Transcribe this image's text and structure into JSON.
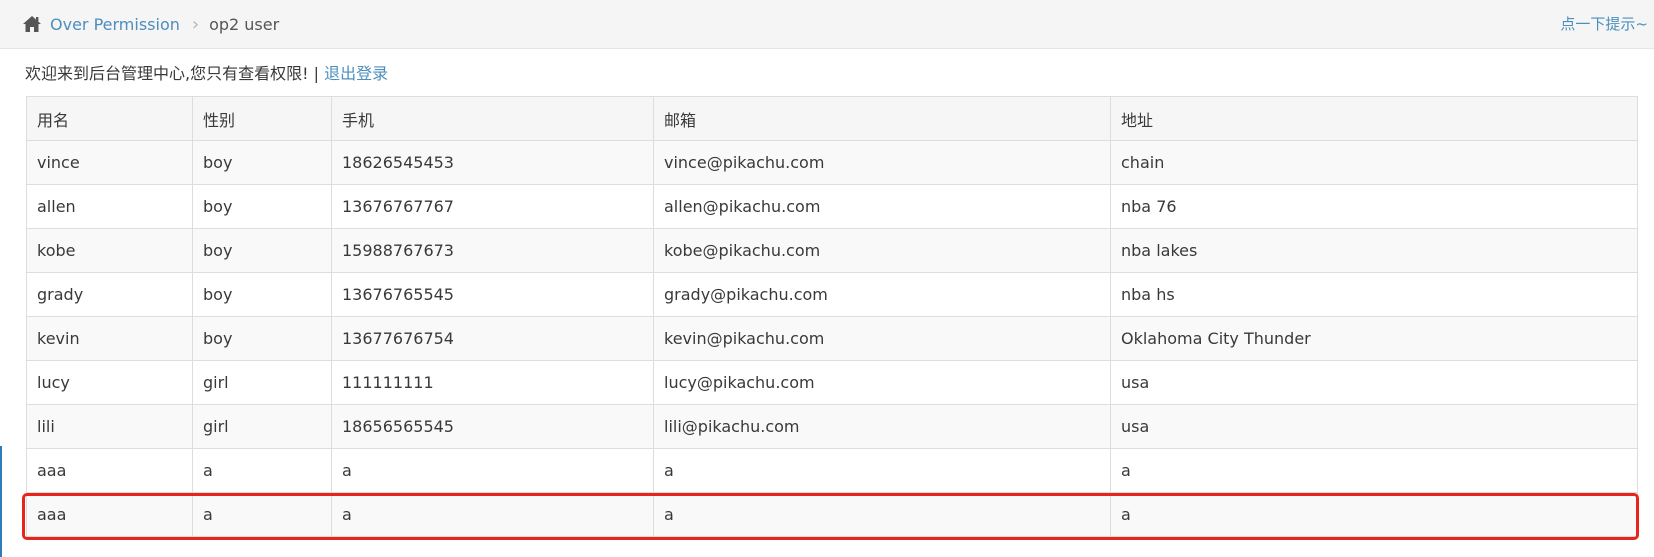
{
  "breadcrumb": {
    "home_icon": "home-icon",
    "link_label": "Over Permission",
    "separator": "›",
    "current": "op2 user"
  },
  "hint_link": "点一下提示~",
  "welcome": {
    "text": "欢迎来到后台管理中心,您只有查看权限! | ",
    "logout_label": "退出登录"
  },
  "table": {
    "headers": [
      "用名",
      "性别",
      "手机",
      "邮箱",
      "地址"
    ],
    "rows": [
      [
        "vince",
        "boy",
        "18626545453",
        "vince@pikachu.com",
        "chain"
      ],
      [
        "allen",
        "boy",
        "13676767767",
        "allen@pikachu.com",
        "nba 76"
      ],
      [
        "kobe",
        "boy",
        "15988767673",
        "kobe@pikachu.com",
        "nba lakes"
      ],
      [
        "grady",
        "boy",
        "13676765545",
        "grady@pikachu.com",
        "nba hs"
      ],
      [
        "kevin",
        "boy",
        "13677676754",
        "kevin@pikachu.com",
        "Oklahoma City Thunder"
      ],
      [
        "lucy",
        "girl",
        "111111111",
        "lucy@pikachu.com",
        "usa"
      ],
      [
        "lili",
        "girl",
        "18656565545",
        "lili@pikachu.com",
        "usa"
      ],
      [
        "aaa",
        "a",
        "a",
        "a",
        "a"
      ],
      [
        "aaa",
        "a",
        "a",
        "a",
        "a"
      ]
    ]
  },
  "highlight_color": "#e8241d",
  "link_color": "#4c8fbd"
}
